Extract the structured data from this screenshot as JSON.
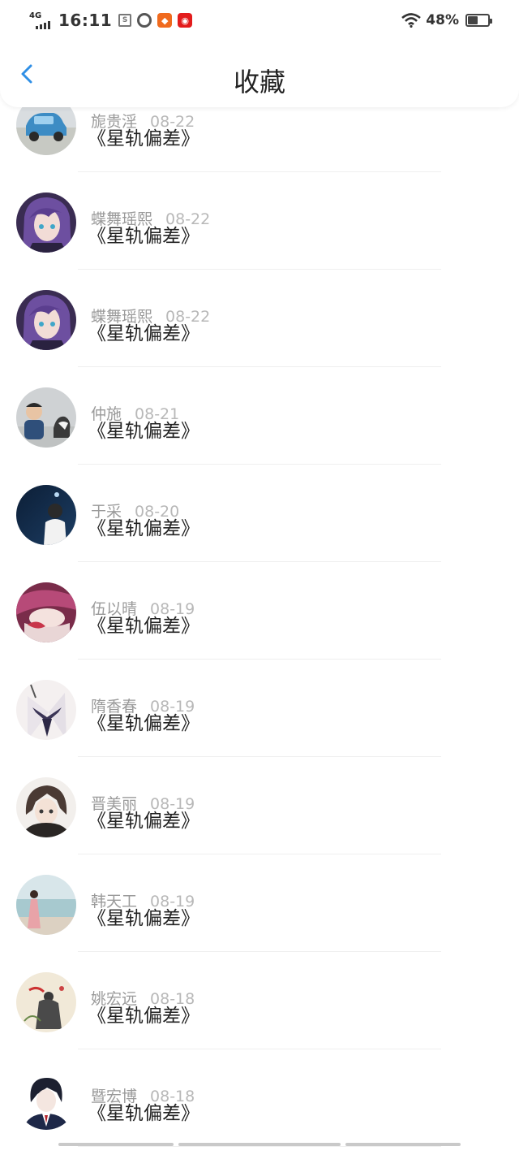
{
  "status_bar": {
    "network": "4G",
    "time": "16:11",
    "battery_percent": "48%",
    "battery_level": 0.48,
    "icons": [
      "signal-icon",
      "screenshot-icon",
      "quark-icon",
      "orange-app-icon",
      "red-app-icon",
      "wifi-icon",
      "battery-icon"
    ]
  },
  "header": {
    "title": "收藏",
    "back_icon": "chevron-left-icon",
    "accent": "#2f8fe6"
  },
  "favorites": [
    {
      "name": "旎贵淫",
      "date": "08-22",
      "book": "《星轨偏差》",
      "avatar": "car"
    },
    {
      "name": "蝶舞瑶熙",
      "date": "08-22",
      "book": "《星轨偏差》",
      "avatar": "anime-purple"
    },
    {
      "name": "蝶舞瑶熙",
      "date": "08-22",
      "book": "《星轨偏差》",
      "avatar": "anime-purple"
    },
    {
      "name": "仲施",
      "date": "08-21",
      "book": "《星轨偏差》",
      "avatar": "child-dog"
    },
    {
      "name": "于采",
      "date": "08-20",
      "book": "《星轨偏差》",
      "avatar": "night-man"
    },
    {
      "name": "伍以晴",
      "date": "08-19",
      "book": "《星轨偏差》",
      "avatar": "pink-anime"
    },
    {
      "name": "隋香春",
      "date": "08-19",
      "book": "《星轨偏差》",
      "avatar": "sailor"
    },
    {
      "name": "晋美丽",
      "date": "08-19",
      "book": "《星轨偏差》",
      "avatar": "anime-boy"
    },
    {
      "name": "韩天工",
      "date": "08-19",
      "book": "《星轨偏差》",
      "avatar": "beach-girl"
    },
    {
      "name": "姚宏远",
      "date": "08-18",
      "book": "《星轨偏差》",
      "avatar": "ink-painting"
    },
    {
      "name": "暨宏博",
      "date": "08-18",
      "book": "《星轨偏差》",
      "avatar": "suit-anime"
    }
  ]
}
